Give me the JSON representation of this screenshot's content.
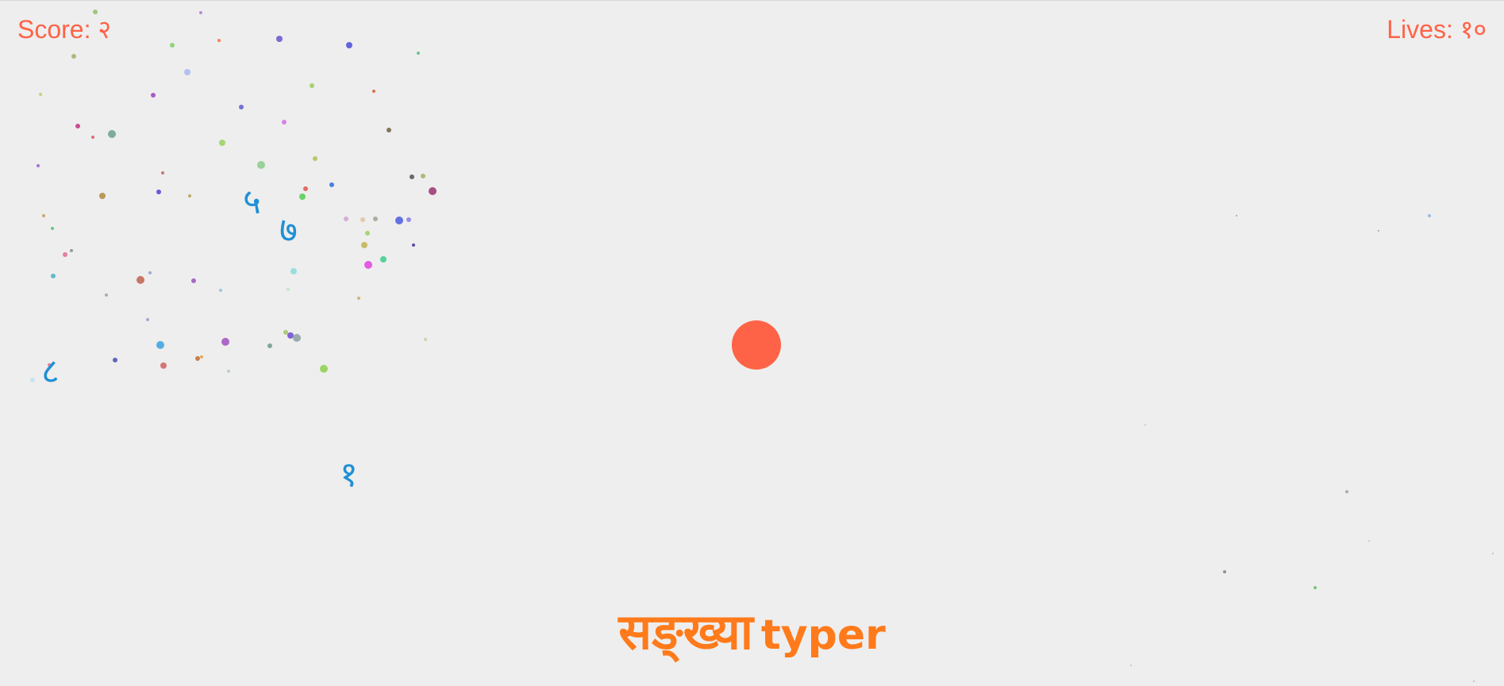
{
  "hud": {
    "score_label": "Score: २",
    "lives_label": "Lives: १०"
  },
  "falling_digits": [
    "५",
    "७",
    "८",
    "१"
  ],
  "title": {
    "main": "सङ्ख्या",
    "sub": "typer"
  },
  "colors": {
    "background": "#eeeeee",
    "hud_text": "#ff6347",
    "digit": "#1e90d6",
    "player": "#ff6347",
    "title": "#ff7a1a"
  }
}
